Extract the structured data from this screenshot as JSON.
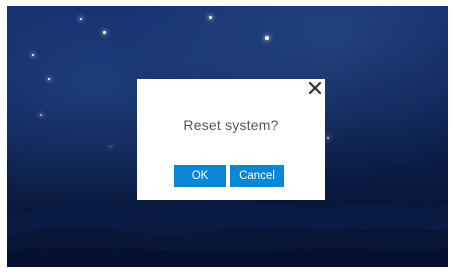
{
  "dialog": {
    "message": "Reset system?",
    "ok_label": "OK",
    "cancel_label": "Cancel",
    "close_icon": "close-icon"
  },
  "colors": {
    "button": "#0a86d6",
    "dialog_bg": "#ffffff",
    "message_text": "#555555"
  }
}
